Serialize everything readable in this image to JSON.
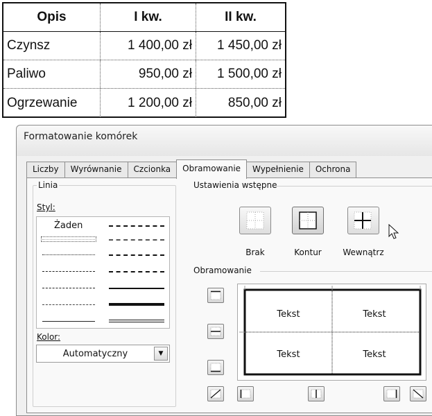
{
  "table": {
    "headers": [
      "Opis",
      "I kw.",
      "II kw."
    ],
    "rows": [
      [
        "Czynsz",
        "1 400,00 zł",
        "1 450,00 zł"
      ],
      [
        "Paliwo",
        "950,00 zł",
        "1 500,00 zł"
      ],
      [
        "Ogrzewanie",
        "1 200,00 zł",
        "850,00 zł"
      ]
    ]
  },
  "dialog": {
    "title": "Formatowanie komórek",
    "tabs": [
      "Liczby",
      "Wyrównanie",
      "Czcionka",
      "Obramowanie",
      "Wypełnienie",
      "Ochrona"
    ],
    "active_tab": "Obramowanie",
    "line_group": {
      "title": "Linia",
      "style_label": "Styl:",
      "none_label": "Żaden",
      "color_label": "Kolor:",
      "color_value": "Automatyczny"
    },
    "presets": {
      "title": "Ustawienia wstępne",
      "items": [
        "Brak",
        "Kontur",
        "Wewnątrz"
      ]
    },
    "border": {
      "title": "Obramowanie",
      "preview_text": [
        "Tekst",
        "Tekst",
        "Tekst",
        "Tekst"
      ]
    }
  }
}
